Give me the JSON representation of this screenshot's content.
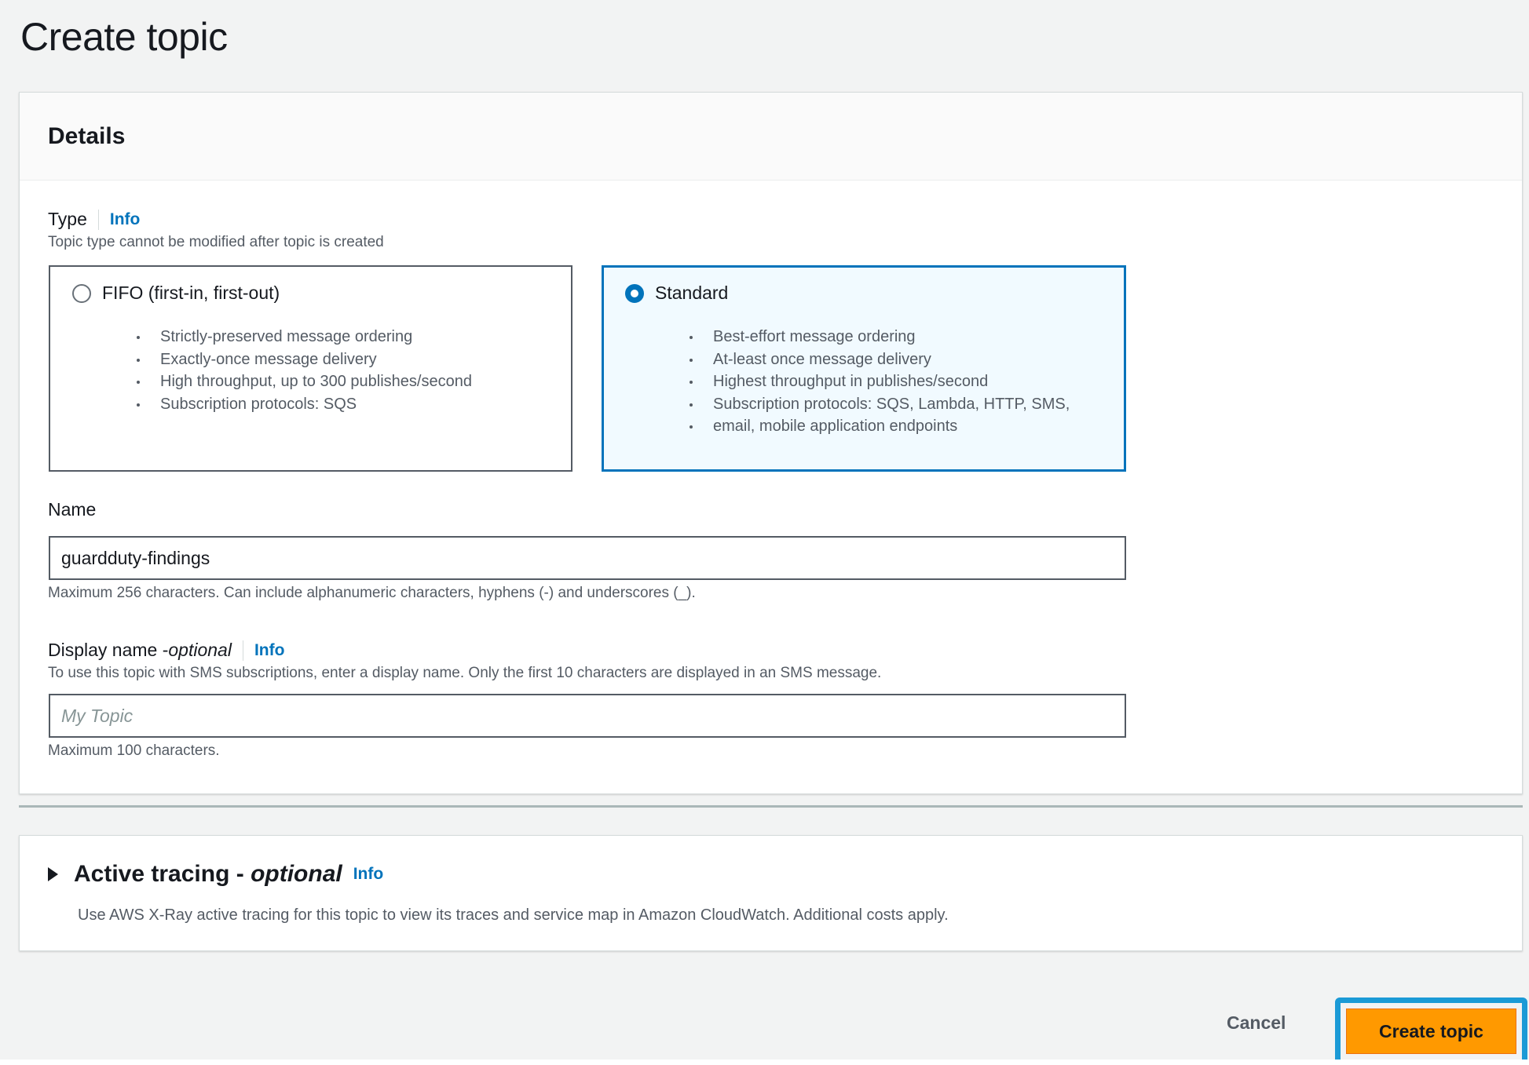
{
  "page": {
    "title": "Create topic"
  },
  "details": {
    "header": "Details",
    "type": {
      "label": "Type",
      "info": "Info",
      "description": "Topic type cannot be modified after topic is created",
      "options": [
        {
          "label": "FIFO (first-in, first-out)",
          "selected": false,
          "bullets": [
            "Strictly-preserved message ordering",
            "Exactly-once message delivery",
            "High throughput, up to 300 publishes/second",
            "Subscription protocols: SQS"
          ]
        },
        {
          "label": "Standard",
          "selected": true,
          "bullets": [
            "Best-effort message ordering",
            "At-least once message delivery",
            "Highest throughput in publishes/second",
            "Subscription protocols: SQS, Lambda, HTTP, SMS,",
            "email, mobile application endpoints"
          ]
        }
      ]
    },
    "name": {
      "label": "Name",
      "value": "guardduty-findings",
      "hint": "Maximum 256 characters. Can include alphanumeric characters, hyphens (-) and underscores (_)."
    },
    "display_name": {
      "label": "Display name - ",
      "optional": "optional",
      "info": "Info",
      "description": "To use this topic with SMS subscriptions, enter a display name. Only the first 10 characters are displayed in an SMS message.",
      "placeholder": "My Topic",
      "hint": "Maximum 100 characters."
    }
  },
  "tracing": {
    "title": "Active tracing - ",
    "optional": "optional",
    "info": "Info",
    "description": "Use AWS X-Ray active tracing for this topic to view its traces and service map in Amazon CloudWatch. Additional costs apply."
  },
  "footer": {
    "cancel": "Cancel",
    "create": "Create topic"
  },
  "colors": {
    "accent": "#0073bb",
    "primary_button": "#ff9900",
    "highlight_frame": "#1b9ad6"
  }
}
